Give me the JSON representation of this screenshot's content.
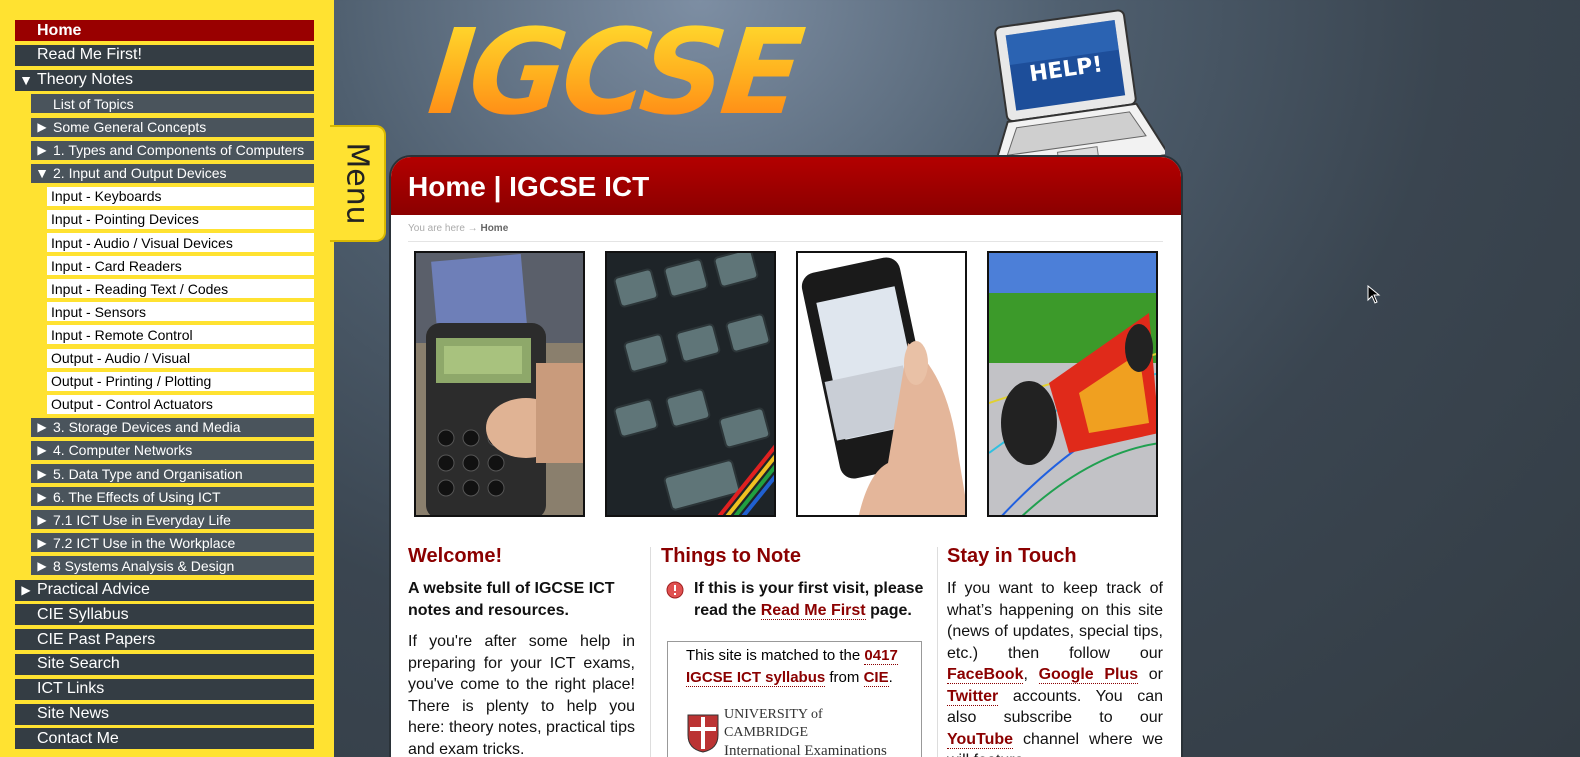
{
  "sidebar": {
    "items": [
      {
        "label": "Home",
        "level": 1,
        "state": "active"
      },
      {
        "label": "Read Me First!",
        "level": 1,
        "state": "plain"
      },
      {
        "label": "Theory Notes",
        "level": 1,
        "state": "expanded"
      },
      {
        "label": "List of Topics",
        "level": 2,
        "state": "plain"
      },
      {
        "label": "Some General Concepts",
        "level": 2,
        "state": "collapsed"
      },
      {
        "label": "1. Types and Components of Computers",
        "level": 2,
        "state": "collapsed"
      },
      {
        "label": "2. Input and Output Devices",
        "level": 2,
        "state": "expanded"
      },
      {
        "label": "Input - Keyboards",
        "level": 3
      },
      {
        "label": "Input - Pointing Devices",
        "level": 3
      },
      {
        "label": "Input - Audio / Visual Devices",
        "level": 3
      },
      {
        "label": "Input - Card Readers",
        "level": 3
      },
      {
        "label": "Input - Reading Text / Codes",
        "level": 3
      },
      {
        "label": "Input - Sensors",
        "level": 3
      },
      {
        "label": "Input - Remote Control",
        "level": 3
      },
      {
        "label": "Output - Audio / Visual",
        "level": 3
      },
      {
        "label": "Output - Printing / Plotting",
        "level": 3
      },
      {
        "label": "Output - Control Actuators",
        "level": 3
      },
      {
        "label": "3. Storage Devices and Media",
        "level": 2,
        "state": "collapsed"
      },
      {
        "label": "4. Computer Networks",
        "level": 2,
        "state": "collapsed"
      },
      {
        "label": "5. Data Type and Organisation",
        "level": 2,
        "state": "collapsed"
      },
      {
        "label": "6. The Effects of Using ICT",
        "level": 2,
        "state": "collapsed"
      },
      {
        "label": "7.1 ICT Use in Everyday Life",
        "level": 2,
        "state": "collapsed"
      },
      {
        "label": "7.2 ICT Use in the Workplace",
        "level": 2,
        "state": "collapsed"
      },
      {
        "label": "8 Systems Analysis & Design",
        "level": 2,
        "state": "collapsed"
      },
      {
        "label": "Practical Advice",
        "level": 1,
        "state": "collapsed"
      },
      {
        "label": "CIE Syllabus",
        "level": 1,
        "state": "plain"
      },
      {
        "label": "CIE Past Papers",
        "level": 1,
        "state": "plain"
      },
      {
        "label": "Site Search",
        "level": 1,
        "state": "plain"
      },
      {
        "label": "ICT Links",
        "level": 1,
        "state": "plain"
      },
      {
        "label": "Site News",
        "level": 1,
        "state": "plain"
      },
      {
        "label": "Contact Me",
        "level": 1,
        "state": "plain"
      }
    ]
  },
  "menu_tab": {
    "label": "Menu"
  },
  "header": {
    "logo_text": "IGCSE ICT",
    "laptop_screen_text": "HELP!"
  },
  "page": {
    "title": "Home | IGCSE ICT",
    "breadcrumb_prefix": "You are here →",
    "breadcrumb_current": "Home"
  },
  "photos": [
    {
      "icon": "card-reader-photo"
    },
    {
      "icon": "keyboard-keys-photo"
    },
    {
      "icon": "smartphone-photo"
    },
    {
      "icon": "f1-car-simulation-photo"
    }
  ],
  "welcome": {
    "heading": "Welcome!",
    "lead": "A website full of IGCSE ICT notes and resources.",
    "body": "If you're after some help in preparing for your ICT exams, you've come to the right place! There is plenty to help you here: theory notes, practical tips and exam tricks."
  },
  "note": {
    "heading": "Things to Note",
    "first_visit_pre": "If this is your first visit, please read the",
    "first_visit_link": "Read Me First",
    "first_visit_post": "page.",
    "syllabus_pre": "This site is matched to the",
    "syllabus_link": "0417 IGCSE ICT syllabus",
    "syllabus_mid": "from",
    "cie_link": "CIE",
    "syllabus_post": ".",
    "cambridge_line1": "UNIVERSITY of CAMBRIDGE",
    "cambridge_line2": "International Examinations"
  },
  "touch": {
    "heading": "Stay in Touch",
    "pre": "If you want to keep track of what’s happening on this site (news of updates, special tips, etc.) then follow our",
    "facebook": "FaceBook",
    "comma": ",",
    "googleplus": "Google Plus",
    "or": "or",
    "twitter": "Twitter",
    "mid": "accounts. You can also subscribe to our",
    "youtube": "YouTube",
    "post": "channel where we will feature"
  },
  "colors": {
    "sidebar_bg": "#ffe231",
    "nav_dark": "#343d44",
    "accent": "#8b0000"
  }
}
